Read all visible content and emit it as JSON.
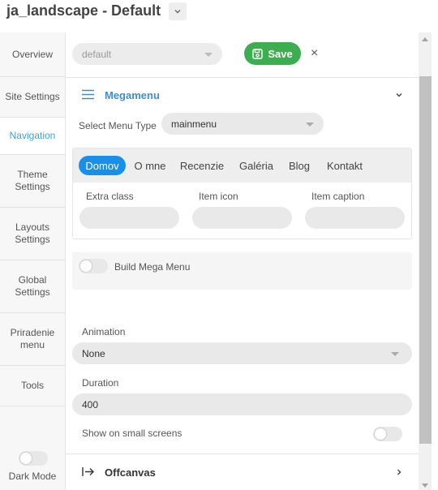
{
  "header": {
    "title": "ja_landscape - Default"
  },
  "sidebar": {
    "items": [
      {
        "label": "Overview"
      },
      {
        "label": "Site Settings"
      },
      {
        "label": "Navigation"
      },
      {
        "label": "Theme Settings"
      },
      {
        "label": "Layouts Settings"
      },
      {
        "label": "Global Settings"
      },
      {
        "label": "Priradenie menu"
      },
      {
        "label": "Tools"
      }
    ],
    "active_index": 2,
    "dark_mode_label": "Dark Mode"
  },
  "topbar": {
    "preset_value": "default",
    "save_label": "Save",
    "close_symbol": "×"
  },
  "megamenu": {
    "title": "Megamenu",
    "select_menu_type_label": "Select Menu Type",
    "menu_type_value": "mainmenu",
    "tabs": [
      "Domov",
      "O mne",
      "Recenzie",
      "Galéria",
      "Blog",
      "Kontakt"
    ],
    "active_tab": "Domov",
    "fields": [
      {
        "label": "Extra class",
        "value": ""
      },
      {
        "label": "Item icon",
        "value": ""
      },
      {
        "label": "Item caption",
        "value": ""
      }
    ],
    "build_label": "Build Mega Menu",
    "animation_label": "Animation",
    "animation_value": "None",
    "duration_label": "Duration",
    "duration_value": "400",
    "small_screens_label": "Show on small screens"
  },
  "offcanvas": {
    "title": "Offcanvas"
  },
  "colors": {
    "accent": "#3c8ed6",
    "tab_active": "#1a8fe8",
    "save_green": "#3dae4f"
  }
}
